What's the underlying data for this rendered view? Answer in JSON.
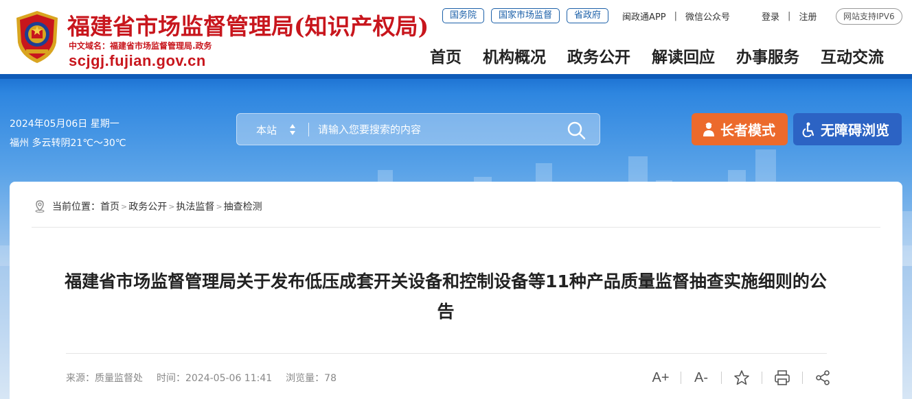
{
  "header": {
    "site_title": "福建省市场监督管理局(知识产权局)",
    "cn_domain": "中文域名：福建省市场监督管理局.政务",
    "en_domain": "scjgj.fujian.gov.cn",
    "pill_links": [
      "国务院",
      "国家市场监督",
      "省政府"
    ],
    "app_link": "闽政通APP",
    "wechat_link": "微信公众号",
    "login": "登录",
    "register": "注册",
    "ipv6": "网站支持IPV6"
  },
  "nav": {
    "items": [
      "首页",
      "机构概况",
      "政务公开",
      "解读回应",
      "办事服务",
      "互动交流"
    ]
  },
  "banner": {
    "date": "2024年05月06日 星期一",
    "weather": "福州 多云转阴21℃～30℃",
    "search_scope": "本站",
    "search_placeholder": "请输入您要搜索的内容",
    "elder_mode": "长者模式",
    "accessibility": "无障碍浏览"
  },
  "breadcrumb": {
    "prefix": "当前位置：",
    "items": [
      "首页",
      "政务公开",
      "执法监督",
      "抽查检测"
    ]
  },
  "article": {
    "title": "福建省市场监督管理局关于发布低压成套开关设备和控制设备等11种产品质量监督抽查实施细则的公告",
    "source": "来源：质量监督处",
    "time": "时间：2024-05-06 11:41",
    "views": "浏览量：78",
    "font_larger": "A+",
    "font_smaller": "A-"
  },
  "colors": {
    "brand_red": "#c8161d",
    "nav_blue": "#1a5fa8",
    "elder_orange": "#ec6a2c",
    "access_blue": "#2c63c4"
  }
}
